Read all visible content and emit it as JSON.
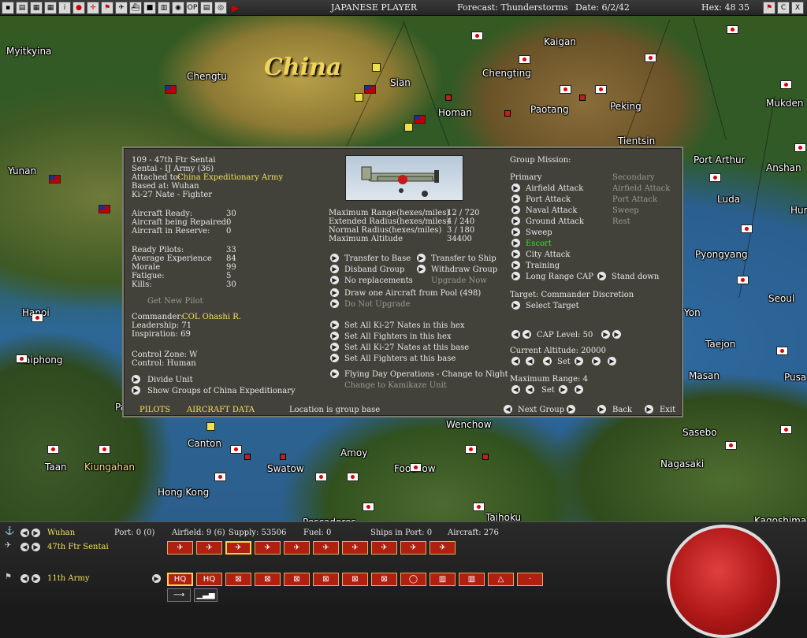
{
  "topbar": {
    "buttons": [
      "▪",
      "▤",
      "▦",
      "▦",
      "i",
      "●",
      "✛",
      "⚑",
      "✈",
      "⛴",
      "■",
      "▥",
      "◉",
      "OP",
      "▤",
      "◎"
    ],
    "player": "JAPANESE PLAYER",
    "forecast": "Forecast: Thunderstorms",
    "date": "Date: 6/2/42",
    "hex": "Hex: 48 35",
    "right_buttons": [
      "⚑",
      "C",
      "X"
    ]
  },
  "map": {
    "region_label": "China",
    "places": [
      {
        "name": "Myitkyina",
        "cls": ""
      },
      {
        "name": "Chengtu",
        "cls": ""
      },
      {
        "name": "Sian",
        "cls": ""
      },
      {
        "name": "Kaigan",
        "cls": ""
      },
      {
        "name": "Chengting",
        "cls": ""
      },
      {
        "name": "Homan",
        "cls": ""
      },
      {
        "name": "Paotang",
        "cls": ""
      },
      {
        "name": "Peking",
        "cls": ""
      },
      {
        "name": "Mukden",
        "cls": ""
      },
      {
        "name": "Tientsin",
        "cls": ""
      },
      {
        "name": "Yunan",
        "cls": ""
      },
      {
        "name": "Port Arthur",
        "cls": ""
      },
      {
        "name": "Anshan",
        "cls": ""
      },
      {
        "name": "Luda",
        "cls": ""
      },
      {
        "name": "Hur",
        "cls": ""
      },
      {
        "name": "Pyongyang",
        "cls": ""
      },
      {
        "name": "Seoul",
        "cls": ""
      },
      {
        "name": "Yon",
        "cls": ""
      },
      {
        "name": "Taejon",
        "cls": ""
      },
      {
        "name": "Masan",
        "cls": ""
      },
      {
        "name": "Pusa",
        "cls": ""
      },
      {
        "name": "Hanoi",
        "cls": ""
      },
      {
        "name": "Haiphong",
        "cls": ""
      },
      {
        "name": "Pa",
        "cls": ""
      },
      {
        "name": "Wenchow",
        "cls": ""
      },
      {
        "name": "Canton",
        "cls": ""
      },
      {
        "name": "Amoy",
        "cls": ""
      },
      {
        "name": "Sasebo",
        "cls": ""
      },
      {
        "name": "Nagasaki",
        "cls": ""
      },
      {
        "name": "Swatow",
        "cls": ""
      },
      {
        "name": "Foochow",
        "cls": ""
      },
      {
        "name": "Taan",
        "cls": ""
      },
      {
        "name": "Kiungahan",
        "cls": "yellow"
      },
      {
        "name": "Hong Kong",
        "cls": ""
      },
      {
        "name": "Pescadores",
        "cls": ""
      },
      {
        "name": "Taihoku",
        "cls": ""
      },
      {
        "name": "Kagoshima",
        "cls": ""
      }
    ]
  },
  "panel": {
    "unit_name": "109 - 47th Ftr Sentai",
    "unit_type": "Sentai - IJ Army (36)",
    "attached_label": "Attached to:",
    "attached_value": "China Expeditionary Army",
    "based_at": "Based at:  Wuhan",
    "aircraft": "Ki-27 Nate - Fighter",
    "aircraft_ready_label": "Aircraft Ready:",
    "aircraft_ready": "30",
    "aircraft_repair_label": "Aircraft being Repaired:",
    "aircraft_repair": "0",
    "aircraft_reserve_label": "Aircraft in Reserve:",
    "aircraft_reserve": "0",
    "ready_pilots_label": "Ready Pilots:",
    "ready_pilots": "33",
    "avg_exp_label": "Average Experience",
    "avg_exp": "84",
    "morale_label": "Morale",
    "morale": "99",
    "fatigue_label": "Fatigue:",
    "fatigue": "5",
    "kills_label": "Kills:",
    "kills": "30",
    "get_new_pilot": "Get New Pilot",
    "commander_label": "Commander:",
    "commander": "COL Ohashi R.",
    "leadership": "Leadership: 71",
    "inspiration": "Inspiration: 69",
    "control_zone": "Control Zone: W",
    "control": "Control:     Human",
    "divide_unit": "Divide Unit",
    "show_groups": "Show Groups of China Expeditionary",
    "tab_pilots": "PILOTS",
    "tab_aircraft": "AIRCRAFT DATA",
    "location_note": "Location is group base",
    "max_range_label": "Maximum Range(hexes/miles)",
    "max_range": "12 / 720",
    "ext_radius_label": "Extended Radius(hexes/miles)",
    "ext_radius": "4 / 240",
    "norm_radius_label": "Normal Radius(hexes/miles)",
    "norm_radius": "3 / 180",
    "max_alt_label": "Maximum Altitude",
    "max_alt": "34400",
    "transfer_base": "Transfer to Base",
    "transfer_ship": "Transfer to Ship",
    "disband": "Disband Group",
    "withdraw": "Withdraw Group",
    "no_repl": "No replacements",
    "upgrade_now": "Upgrade Now",
    "draw_one": "Draw one Aircraft from Pool (498)",
    "no_upgrade": "Do Not Upgrade",
    "set_all_1": "Set All Ki-27 Nates in this hex",
    "set_all_2": "Set All Fighters in this hex",
    "set_all_3": "Set All Ki-27 Nates at this base",
    "set_all_4": "Set All Fighters at this base",
    "flying_day": "Flying Day Operations - Change to Night",
    "kamikaze": "Change to Kamikaze Unit",
    "group_mission": "Group Mission:",
    "primary": "Primary",
    "secondary": "Secondary",
    "missions": [
      "Airfield Attack",
      "Port Attack",
      "Naval Attack",
      "Ground Attack",
      "Sweep",
      "Escort",
      "City Attack",
      "Training",
      "Long Range CAP"
    ],
    "secondary_missions": [
      "Airfield Attack",
      "Port Attack",
      "Sweep",
      "Rest"
    ],
    "stand_down": "Stand down",
    "target": "Target: Commander Discretion",
    "select_target": "Select Target",
    "cap_level": "CAP Level: 50",
    "current_alt": "Current Altitude: 20000",
    "set": "Set",
    "max_range_title": "Maximum Range: 4",
    "next_group": "Next Group",
    "back": "Back",
    "exit": "Exit"
  },
  "bottom": {
    "base": "Wuhan",
    "port": "Port: 0 (0)",
    "airfield": "Airfield: 9 (6)",
    "supply": "Supply: 53506",
    "fuel": "Fuel: 0",
    "ships": "Ships in Port: 0",
    "aircraft": "Aircraft: 276",
    "air_unit": "47th Ftr Sentai",
    "ground_unit": "11th Army",
    "ground_icons": [
      "HQ",
      "HQ",
      "⊠",
      "⊠",
      "⊠",
      "⊠",
      "⊠",
      "⊠",
      "◯",
      "▥",
      "▥",
      "△",
      "·"
    ]
  }
}
